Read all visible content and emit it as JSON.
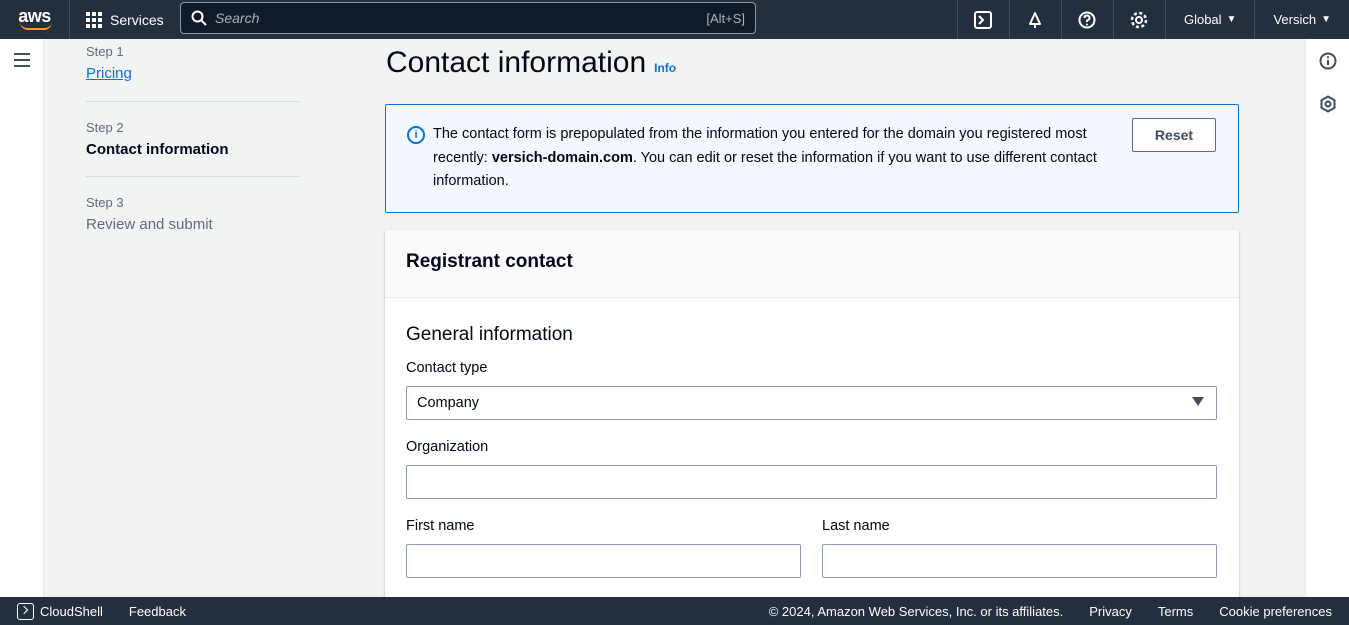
{
  "topbar": {
    "logo_text": "aws",
    "services_label": "Services",
    "search_placeholder": "Search",
    "search_shortcut": "[Alt+S]",
    "region_label": "Global",
    "account_label": "Versich",
    "icons": [
      "cloudshell-icon",
      "bell-icon",
      "help-icon",
      "gear-icon"
    ]
  },
  "steps": [
    {
      "number": "Step 1",
      "label": "Pricing",
      "state": "link"
    },
    {
      "number": "Step 2",
      "label": "Contact information",
      "state": "active"
    },
    {
      "number": "Step 3",
      "label": "Review and submit",
      "state": "disabled"
    }
  ],
  "page": {
    "title": "Contact information",
    "info_link": "Info"
  },
  "alert": {
    "text_before": "The contact form is prepopulated from the information you entered for the domain you registered most recently: ",
    "domain": "versich-domain.com",
    "text_after": ". You can edit or reset the information if you want to use different contact information.",
    "reset_label": "Reset"
  },
  "form": {
    "panel_title": "Registrant contact",
    "section_title": "General information",
    "contact_type_label": "Contact type",
    "contact_type_value": "Company",
    "organization_label": "Organization",
    "organization_value": "",
    "first_name_label": "First name",
    "first_name_value": "",
    "last_name_label": "Last name",
    "last_name_value": ""
  },
  "footer": {
    "cloudshell_label": "CloudShell",
    "feedback_label": "Feedback",
    "copyright": "© 2024, Amazon Web Services, Inc. or its affiliates.",
    "privacy_label": "Privacy",
    "terms_label": "Terms",
    "cookie_label": "Cookie preferences"
  },
  "colors": {
    "topbar_bg": "#232f3e",
    "link": "#0972d3",
    "alert_bg": "#f2f8fd",
    "brand_orange": "#ff9900"
  }
}
